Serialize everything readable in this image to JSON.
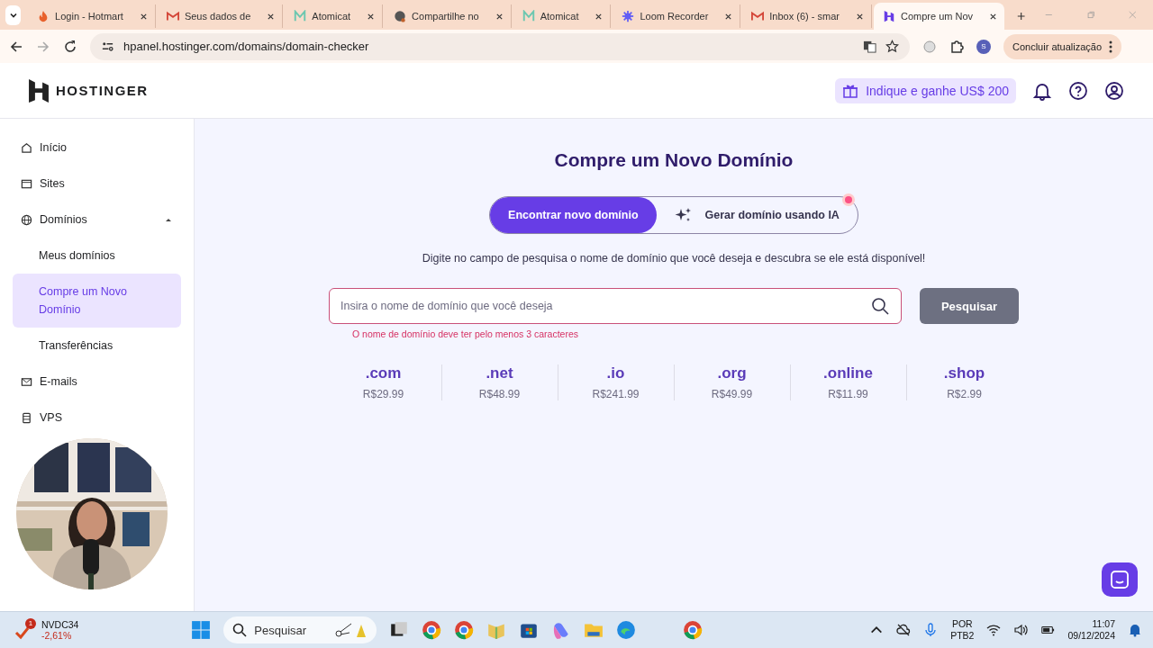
{
  "browser": {
    "tabs": [
      {
        "title": "Login - Hotmart",
        "selected": false
      },
      {
        "title": "Seus dados de",
        "selected": false
      },
      {
        "title": "Atomicat",
        "selected": false
      },
      {
        "title": "Compartilhe no",
        "selected": false
      },
      {
        "title": "Atomicat",
        "selected": false
      },
      {
        "title": "Loom Recorder",
        "selected": false
      },
      {
        "title": "Inbox (6) - smar",
        "selected": false
      },
      {
        "title": "Compre um Nov",
        "selected": true
      }
    ],
    "url": "hpanel.hostinger.com/domains/domain-checker",
    "profile": "S",
    "update_button": "Concluir atualização"
  },
  "header": {
    "logo": "HOSTINGER",
    "referral": "Indique e ganhe US$ 200"
  },
  "sidebar": {
    "items": [
      {
        "label": "Início",
        "selected": false
      },
      {
        "label": "Sites",
        "selected": false
      },
      {
        "label": "Domínios",
        "selected": false,
        "expanded": true,
        "children": [
          {
            "label": "Meus domínios",
            "selected": false
          },
          {
            "label": "Compre um Novo Domínio",
            "selected": true
          },
          {
            "label": "Transferências",
            "selected": false
          }
        ]
      },
      {
        "label": "E-mails",
        "selected": false
      },
      {
        "label": "VPS",
        "selected": false
      }
    ]
  },
  "main": {
    "title": "Compre um Novo Domínio",
    "mode_tabs": [
      {
        "label": "Encontrar novo domínio",
        "selected": true
      },
      {
        "label": "Gerar domínio usando IA",
        "selected": false
      }
    ],
    "hint": "Digite no campo de pesquisa o nome de domínio que você deseja e descubra se ele está disponível!",
    "search": {
      "placeholder": "Insira o nome de domínio que você deseja"
    },
    "error": "O nome de domínio deve ter pelo menos 3 caracteres",
    "search_button": "Pesquisar",
    "tlds": [
      {
        "name": ".com",
        "price": "R$29.99"
      },
      {
        "name": ".net",
        "price": "R$48.99"
      },
      {
        "name": ".io",
        "price": "R$241.99"
      },
      {
        "name": ".org",
        "price": "R$49.99"
      },
      {
        "name": ".online",
        "price": "R$11.99"
      },
      {
        "name": ".shop",
        "price": "R$2.99"
      }
    ]
  },
  "taskbar": {
    "stock": {
      "symbol": "NVDC34",
      "change": "-2,61%",
      "badge": "1"
    },
    "search_placeholder": "Pesquisar",
    "language": "POR",
    "layout": "PTB2",
    "time": "11:07",
    "date": "09/12/2024"
  }
}
